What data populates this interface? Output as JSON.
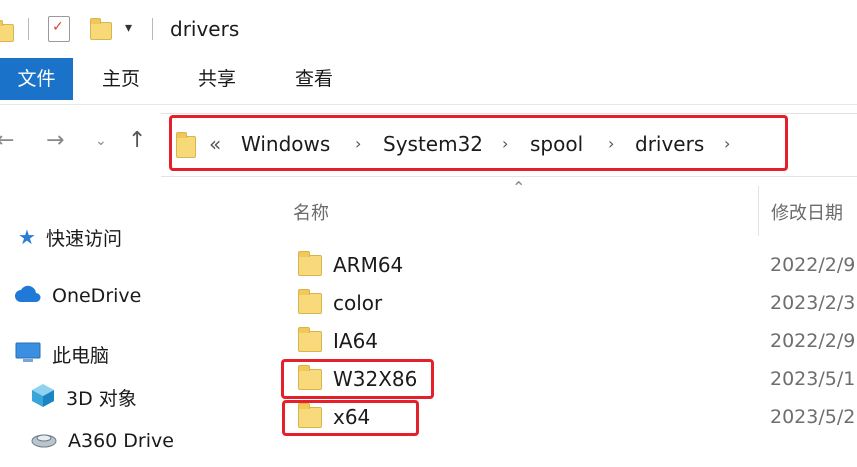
{
  "window": {
    "title": "drivers"
  },
  "ribbon": {
    "tabs": [
      "文件",
      "主页",
      "共享",
      "查看"
    ]
  },
  "address": {
    "overflow": "«",
    "crumbs": [
      "Windows",
      "System32",
      "spool",
      "drivers"
    ]
  },
  "columns": {
    "name": "名称",
    "date": "修改日期"
  },
  "sidebar": {
    "items": [
      {
        "label": "快速访问",
        "icon": "star-icon"
      },
      {
        "label": "OneDrive",
        "icon": "cloud-icon"
      },
      {
        "label": "此电脑",
        "icon": "computer-icon"
      },
      {
        "label": "3D 对象",
        "icon": "cube-icon"
      },
      {
        "label": "A360 Drive",
        "icon": "drive-icon"
      }
    ]
  },
  "files": [
    {
      "name": "ARM64",
      "date": "2022/2/9"
    },
    {
      "name": "color",
      "date": "2023/2/3"
    },
    {
      "name": "IA64",
      "date": "2022/2/9"
    },
    {
      "name": "W32X86",
      "date": "2023/5/1"
    },
    {
      "name": "x64",
      "date": "2023/5/2"
    }
  ],
  "colors": {
    "accent": "#1a73c8",
    "highlight": "#e4212b",
    "folder": "#f8da7c"
  }
}
